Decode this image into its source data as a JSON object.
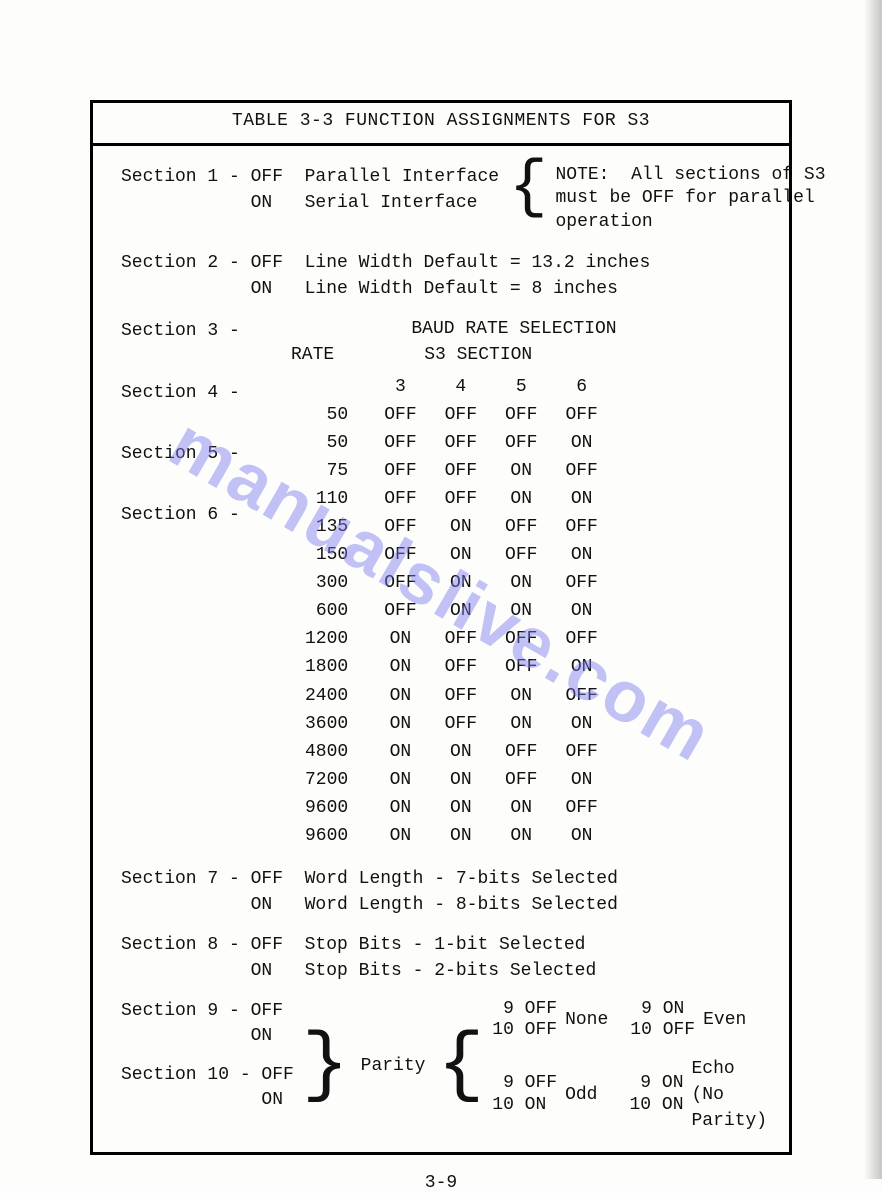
{
  "title": "TABLE 3-3  FUNCTION ASSIGNMENTS FOR S3",
  "section1": {
    "label": "Section 1 - OFF  Parallel Interface",
    "on": "            ON   Serial Interface"
  },
  "note": {
    "l1": "NOTE:  All sections of S3",
    "l2": "must be OFF for parallel",
    "l3": "operation"
  },
  "section2": {
    "off": "Section 2 - OFF  Line Width Default = 13.2 inches",
    "on": "            ON   Line Width Default = 8 inches"
  },
  "section_list": "Section 3 -\n\nSection 4 -\n\nSection 5 -\n\nSection 6 -",
  "baud": {
    "title": "BAUD RATE SELECTION",
    "rate_hdr": "RATE",
    "sect_hdr": "S3 SECTION",
    "cols": [
      "3",
      "4",
      "5",
      "6"
    ],
    "rows": [
      {
        "rate": "50",
        "v": [
          "OFF",
          "OFF",
          "OFF",
          "OFF"
        ]
      },
      {
        "rate": "50",
        "v": [
          "OFF",
          "OFF",
          "OFF",
          "ON"
        ]
      },
      {
        "rate": "75",
        "v": [
          "OFF",
          "OFF",
          "ON",
          "OFF"
        ]
      },
      {
        "rate": "110",
        "v": [
          "OFF",
          "OFF",
          "ON",
          "ON"
        ]
      },
      {
        "rate": "135",
        "v": [
          "OFF",
          "ON",
          "OFF",
          "OFF"
        ]
      },
      {
        "rate": "150",
        "v": [
          "OFF",
          "ON",
          "OFF",
          "ON"
        ]
      },
      {
        "rate": "300",
        "v": [
          "OFF",
          "ON",
          "ON",
          "OFF"
        ]
      },
      {
        "rate": "600",
        "v": [
          "OFF",
          "ON",
          "ON",
          "ON"
        ]
      },
      {
        "rate": "1200",
        "v": [
          "ON",
          "OFF",
          "OFF",
          "OFF"
        ]
      },
      {
        "rate": "1800",
        "v": [
          "ON",
          "OFF",
          "OFF",
          "ON"
        ]
      },
      {
        "rate": "2400",
        "v": [
          "ON",
          "OFF",
          "ON",
          "OFF"
        ]
      },
      {
        "rate": "3600",
        "v": [
          "ON",
          "OFF",
          "ON",
          "ON"
        ]
      },
      {
        "rate": "4800",
        "v": [
          "ON",
          "ON",
          "OFF",
          "OFF"
        ]
      },
      {
        "rate": "7200",
        "v": [
          "ON",
          "ON",
          "OFF",
          "ON"
        ]
      },
      {
        "rate": "9600",
        "v": [
          "ON",
          "ON",
          "ON",
          "OFF"
        ]
      },
      {
        "rate": "9600",
        "v": [
          "ON",
          "ON",
          "ON",
          "ON"
        ]
      }
    ]
  },
  "section7": {
    "off": "Section 7 - OFF  Word Length - 7-bits Selected",
    "on": "            ON   Word Length - 8-bits Selected"
  },
  "section8": {
    "off": "Section 8 - OFF  Stop Bits - 1-bit Selected",
    "on": "            ON   Stop Bits - 2-bits Selected"
  },
  "parity": {
    "s9": "Section 9 - OFF\n            ON",
    "s10": "Section 10 - OFF\n             ON",
    "label": "Parity",
    "p1a": " 9 OFF\n10 OFF",
    "p1b": "None",
    "p1c": " 9 ON\n10 OFF",
    "p1d": "Even",
    "p2a": " 9 OFF\n10 ON",
    "p2b": "Odd",
    "p2c": " 9 ON\n10 ON",
    "p2d": "Echo (No Parity)"
  },
  "page_num": "3-9",
  "watermark": "manualslive.com"
}
